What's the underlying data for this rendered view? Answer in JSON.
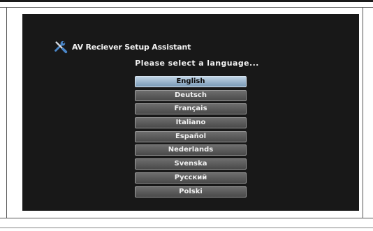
{
  "app": {
    "title": "AV Reciever Setup Assistant",
    "icon": "tools-icon"
  },
  "prompt": "Please select a language...",
  "languages": [
    {
      "label": "English",
      "selected": true
    },
    {
      "label": "Deutsch",
      "selected": false
    },
    {
      "label": "Français",
      "selected": false
    },
    {
      "label": "Italiano",
      "selected": false
    },
    {
      "label": "Español",
      "selected": false
    },
    {
      "label": "Nederlands",
      "selected": false
    },
    {
      "label": "Svenska",
      "selected": false
    },
    {
      "label": "Русский",
      "selected": false
    },
    {
      "label": "Polski",
      "selected": false
    }
  ],
  "colors": {
    "screen_background": "#181818",
    "selected_button": "#9db6cc",
    "button": "#5a5a5a"
  }
}
